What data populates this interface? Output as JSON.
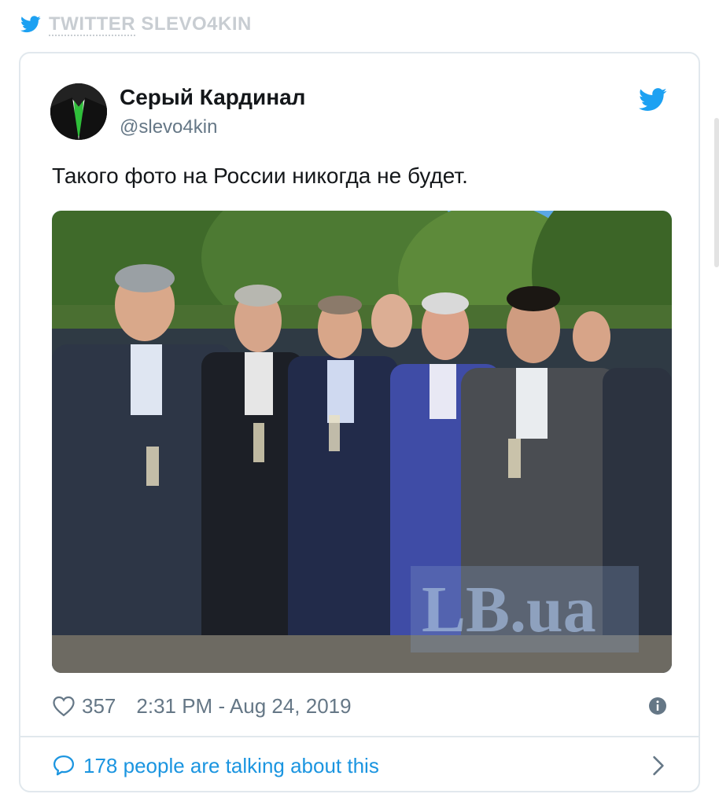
{
  "source": {
    "platform": "TWITTER",
    "account": "SLEVO4KIN"
  },
  "tweet": {
    "display_name": "Серый Кардинал",
    "handle": "@slevo4kin",
    "text": "Такого фото на России никогда не будет.",
    "likes": "357",
    "timestamp": "2:31 PM - Aug 24, 2019",
    "talking": "178 people are talking about this",
    "photo_watermark": "LB.ua"
  },
  "icons": {
    "source_logo": "twitter-bird-icon",
    "avatar": "avatar",
    "brand": "twitter-bird-icon",
    "like": "heart-icon",
    "info": "info-icon",
    "reply": "speech-bubble-icon",
    "more": "chevron-right-icon"
  },
  "colors": {
    "brand": "#1da1f2",
    "link": "#1b95e0",
    "muted": "#657786",
    "text": "#14171a",
    "border": "#e1e8ed"
  }
}
